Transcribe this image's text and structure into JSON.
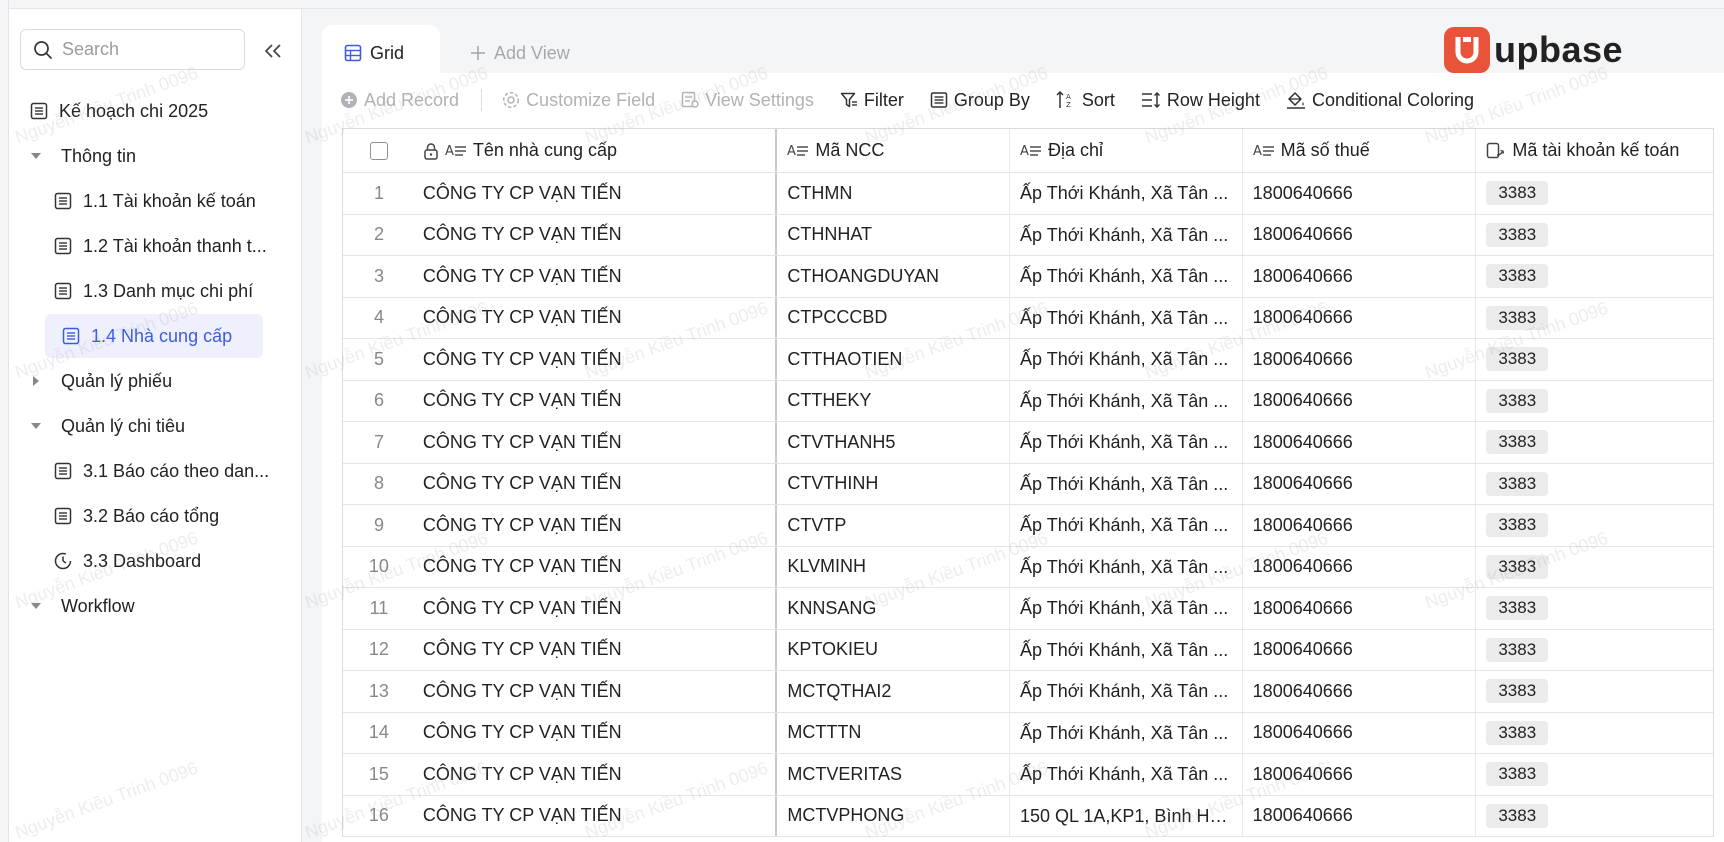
{
  "sidebar": {
    "search_placeholder": "Search",
    "items": [
      {
        "label": "Kế hoạch chi 2025",
        "type": "table"
      },
      {
        "label": "Thông tin",
        "type": "group-open"
      },
      {
        "label": "1.1 Tài khoản kế toán",
        "type": "table"
      },
      {
        "label": "1.2 Tài khoản thanh t...",
        "type": "table"
      },
      {
        "label": "1.3 Danh mục chi phí",
        "type": "table"
      },
      {
        "label": "1.4 Nhà cung cấp",
        "type": "table",
        "active": true
      },
      {
        "label": "Quản lý phiếu",
        "type": "group-closed"
      },
      {
        "label": "Quản lý chi tiêu",
        "type": "group-open"
      },
      {
        "label": "3.1 Báo cáo theo dan...",
        "type": "table"
      },
      {
        "label": "3.2 Báo cáo tổng",
        "type": "table"
      },
      {
        "label": "3.3 Dashboard",
        "type": "dashboard"
      },
      {
        "label": "Workflow",
        "type": "group-open"
      }
    ]
  },
  "tabs": {
    "grid": "Grid",
    "add_view": "Add View"
  },
  "logo": {
    "text": "upbase",
    "color": "#e8533a"
  },
  "toolbar": {
    "add_record": "Add Record",
    "customize_field": "Customize Field",
    "view_settings": "View Settings",
    "filter": "Filter",
    "group_by": "Group By",
    "sort": "Sort",
    "row_height": "Row Height",
    "conditional_coloring": "Conditional Coloring"
  },
  "table": {
    "columns": [
      "Tên nhà cung cấp",
      "Mã NCC",
      "Địa chỉ",
      "Mã số thuế",
      "Mã tài khoản kế toán"
    ],
    "rows": [
      {
        "n": "1",
        "name": "CÔNG TY CP VẠN TIẾN",
        "code": "CTHMN",
        "addr": "Ấp Thới Khánh, Xã Tân ...",
        "tax": "1800640666",
        "acct": "3383"
      },
      {
        "n": "2",
        "name": "CÔNG TY CP VẠN TIẾN",
        "code": "CTHNHAT",
        "addr": "Ấp Thới Khánh, Xã Tân ...",
        "tax": "1800640666",
        "acct": "3383"
      },
      {
        "n": "3",
        "name": "CÔNG TY CP VẠN TIẾN",
        "code": "CTHOANGDUYAN",
        "addr": "Ấp Thới Khánh, Xã Tân ...",
        "tax": "1800640666",
        "acct": "3383"
      },
      {
        "n": "4",
        "name": "CÔNG TY CP VẠN TIẾN",
        "code": "CTPCCCBD",
        "addr": "Ấp Thới Khánh, Xã Tân ...",
        "tax": "1800640666",
        "acct": "3383"
      },
      {
        "n": "5",
        "name": "CÔNG TY CP VẠN TIẾN",
        "code": "CTTHAOTIEN",
        "addr": "Ấp Thới Khánh, Xã Tân ...",
        "tax": "1800640666",
        "acct": "3383"
      },
      {
        "n": "6",
        "name": "CÔNG TY CP VẠN TIẾN",
        "code": "CTTHEKY",
        "addr": "Ấp Thới Khánh, Xã Tân ...",
        "tax": "1800640666",
        "acct": "3383"
      },
      {
        "n": "7",
        "name": "CÔNG TY CP VẠN TIẾN",
        "code": "CTVTHANH5",
        "addr": "Ấp Thới Khánh, Xã Tân ...",
        "tax": "1800640666",
        "acct": "3383"
      },
      {
        "n": "8",
        "name": "CÔNG TY CP VẠN TIẾN",
        "code": "CTVTHINH",
        "addr": "Ấp Thới Khánh, Xã Tân ...",
        "tax": "1800640666",
        "acct": "3383"
      },
      {
        "n": "9",
        "name": "CÔNG TY CP VẠN TIẾN",
        "code": "CTVTP",
        "addr": "Ấp Thới Khánh, Xã Tân ...",
        "tax": "1800640666",
        "acct": "3383"
      },
      {
        "n": "10",
        "name": "CÔNG TY CP VẠN TIẾN",
        "code": "KLVMINH",
        "addr": "Ấp Thới Khánh, Xã Tân ...",
        "tax": "1800640666",
        "acct": "3383"
      },
      {
        "n": "11",
        "name": "CÔNG TY CP VẠN TIẾN",
        "code": "KNNSANG",
        "addr": "Ấp Thới Khánh, Xã Tân ...",
        "tax": "1800640666",
        "acct": "3383"
      },
      {
        "n": "12",
        "name": "CÔNG TY CP VẠN TIẾN",
        "code": "KPTOKIEU",
        "addr": "Ấp Thới Khánh, Xã Tân ...",
        "tax": "1800640666",
        "acct": "3383"
      },
      {
        "n": "13",
        "name": "CÔNG TY CP VẠN TIẾN",
        "code": "MCTQTHAI2",
        "addr": "Ấp Thới Khánh, Xã Tân ...",
        "tax": "1800640666",
        "acct": "3383"
      },
      {
        "n": "14",
        "name": "CÔNG TY CP VẠN TIẾN",
        "code": "MCTTTN",
        "addr": "Ấp Thới Khánh, Xã Tân ...",
        "tax": "1800640666",
        "acct": "3383"
      },
      {
        "n": "15",
        "name": "CÔNG TY CP VẠN TIẾN",
        "code": "MCTVERITAS",
        "addr": "Ấp Thới Khánh, Xã Tân ...",
        "tax": "1800640666",
        "acct": "3383"
      },
      {
        "n": "16",
        "name": "CÔNG TY CP VẠN TIẾN",
        "code": "MCTVPHONG",
        "addr": "150 QL 1A,KP1, Bình Hư...",
        "tax": "1800640666",
        "acct": "3383"
      }
    ]
  },
  "watermark": "Nguyễn Kiều Trinh 0096",
  "colors": {
    "accent": "#3f5be0",
    "active_bg": "#eef0fd",
    "brand": "#e8533a"
  }
}
